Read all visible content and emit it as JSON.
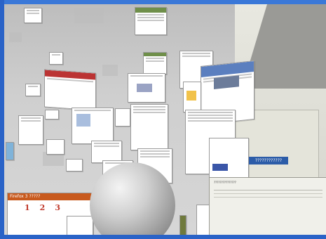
{
  "scene": {
    "firefox_page": {
      "header": "Firefox 3 ?????",
      "steps": [
        "1",
        "2",
        "3"
      ]
    },
    "japanese_banner": "????????????",
    "doc_panel_title": "???????????????"
  },
  "colors": {
    "frame": "#2a63c7",
    "floor": "#c8c8c8",
    "sphere": "#bcbcbc"
  }
}
